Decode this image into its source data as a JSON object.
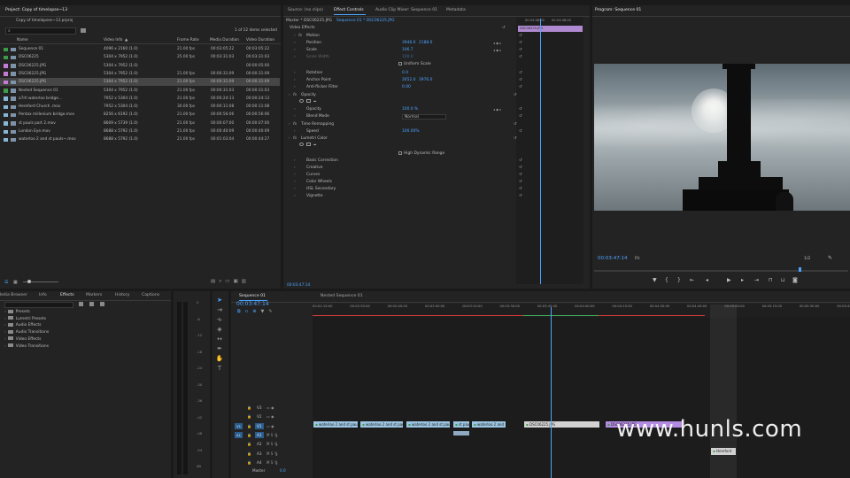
{
  "project": {
    "tab": "Project: Copy of timelapse~13",
    "file": "Copy of timelapses~13.prproj",
    "items_selected": "1 of 12 items selected",
    "columns": [
      "Name",
      "Video Info",
      "Frame Rate",
      "Media Duration",
      "Video Duration"
    ],
    "rows": [
      {
        "name": "Sequence 01",
        "info": "4096 x 2160 (1.0)",
        "rate": "21.00 fps",
        "media": "00:03:05:22",
        "video": "00:03:05:22",
        "color": "#3d9b46"
      },
      {
        "name": "DSC06225",
        "info": "5304 x 7952 (1.0)",
        "rate": "25.00 fps",
        "media": "00:03:31:03",
        "video": "00:03:31:03",
        "color": "#3d9b46"
      },
      {
        "name": "DSC06225.JPG",
        "info": "5304 x 7952 (1.0)",
        "rate": "",
        "media": "",
        "video": "00:00:05:00",
        "color": "#c57bd6"
      },
      {
        "name": "DSC06225.JPG",
        "info": "5304 x 7952 (1.0)",
        "rate": "21.00 fps",
        "media": "00:00:31:09",
        "video": "00:00:31:09",
        "color": "#c57bd6"
      },
      {
        "name": "DSC06225.JPG",
        "info": "5304 x 7952 (1.0)",
        "rate": "21.00 fps",
        "media": "00:00:31:09",
        "video": "00:00:31:09",
        "color": "#c57bd6",
        "selected": true
      },
      {
        "name": "Nested Sequence 01",
        "info": "5304 x 7952 (1.0)",
        "rate": "21.00 fps",
        "media": "00:00:31:03",
        "video": "00:00:31:03",
        "color": "#3d9b46"
      },
      {
        "name": "a7rII waterloo bridge...",
        "info": "7952 x 5304 (1.0)",
        "rate": "21.00 fps",
        "media": "00:00:24:13",
        "video": "00:00:24:13",
        "color": "#8ab6d6"
      },
      {
        "name": "Hereford Church .mov",
        "info": "7952 x 5304 (1.0)",
        "rate": "30.00 fps",
        "media": "00:00:11:08",
        "video": "00:00:11:08",
        "color": "#8ab6d6"
      },
      {
        "name": "Pentax millenium bridge.mov",
        "info": "8256 x 6192 (1.0)",
        "rate": "21.00 fps",
        "media": "00:00:56:06",
        "video": "00:00:56:06",
        "color": "#8ab6d6"
      },
      {
        "name": "st pauls part 2.mov",
        "info": "8609 x 5739 (1.0)",
        "rate": "21.00 fps",
        "media": "00:00:07:00",
        "video": "00:00:07:00",
        "color": "#8ab6d6"
      },
      {
        "name": "London Eye.mov",
        "info": "8688 x 5792 (1.0)",
        "rate": "21.00 fps",
        "media": "00:00:40:09",
        "video": "00:00:40:09",
        "color": "#8ab6d6"
      },
      {
        "name": "waterloo 2 and st pauls~.mov",
        "info": "8688 x 5792 (1.0)",
        "rate": "21.00 fps",
        "media": "00:01:03:04",
        "video": "00:00:44:27",
        "color": "#8ab6d6"
      }
    ]
  },
  "source_tabs": {
    "source": "Source: (no clips)",
    "effect_controls": "Effect Controls",
    "audio_mixer": "Audio Clip Mixer: Sequence 01",
    "metadata": "Metadata"
  },
  "effect_controls": {
    "master": "Master * DSC06225.JPG",
    "seq": "Sequence 01 * DSC06225.JPG",
    "ruler_a": "00:03:46:00",
    "ruler_b": "00:03:48:00",
    "clip": "DSC06225.JPG",
    "video_effects": "Video Effects",
    "motion": "Motion",
    "position": "Position",
    "position_x": "3948.0",
    "position_y": "2188.6",
    "scale": "Scale",
    "scale_val": "106.7",
    "scale_width": "Scale Width",
    "scale_width_val": "100.0",
    "uniform_scale": "Uniform Scale",
    "rotation": "Rotation",
    "rotation_val": "0.0",
    "anchor_point": "Anchor Point",
    "anchor_x": "2652.0",
    "anchor_y": "3976.0",
    "anti_flicker": "Anti-flicker Filter",
    "anti_flicker_val": "0.00",
    "opacity": "Opacity",
    "opacity_label": "Opacity",
    "opacity_val": "100.0 %",
    "blend_mode": "Blend Mode",
    "blend_val": "Normal",
    "time_remapping": "Time Remapping",
    "speed": "Speed",
    "speed_val": "100.00%",
    "lumetri": "Lumetri Color",
    "hdr": "High Dynamic Range",
    "basic": "Basic Correction",
    "creative": "Creative",
    "curves": "Curves",
    "wheels": "Color Wheels",
    "hsl": "HSL Secondary",
    "vignette": "Vignette",
    "timecode": "00:03:47:14"
  },
  "program": {
    "tab": "Program: Sequence 01",
    "timecode": "00:03:47:14",
    "fit": "Fit",
    "quality": "1/2"
  },
  "effects_panel": {
    "tabs": [
      "Media Browser",
      "Info",
      "Effects",
      "Markers",
      "History",
      "Captions"
    ],
    "items": [
      "Presets",
      "Lumetri Presets",
      "Audio Effects",
      "Audio Transitions",
      "Video Effects",
      "Video Transitions"
    ]
  },
  "meters": [
    "0",
    "-6",
    "-12",
    "-18",
    "-24",
    "-30",
    "-36",
    "-42",
    "-48",
    "-54",
    "dB"
  ],
  "timeline": {
    "tab1": "Sequence 01",
    "tab2": "Nested Sequence 01",
    "timecode": "00:03:47:14",
    "ruler": [
      "00:02:15:00",
      "00:02:30:00",
      "00:02:45:00",
      "00:03:00:00",
      "00:03:15:00",
      "00:03:30:00",
      "00:03:45:00",
      "00:04:00:00",
      "00:04:15:00",
      "00:04:30:00",
      "00:04:45:00",
      "00:05:00:00",
      "00:05:15:00",
      "00:05:30:00",
      "00:05:45:00"
    ],
    "tracks": [
      "V3",
      "V2",
      "V1",
      "A1",
      "A2",
      "A3",
      "A4"
    ],
    "master": "Master",
    "master_val": "0.0",
    "clips": [
      "waterloo 2 and st pauls",
      "waterloo 2 and st pauls",
      "waterloo 2 and st pauls",
      "st pauls",
      "waterloo 2 and",
      "DSC06225.JPG",
      "DSC06225.JPG",
      "Hereford"
    ]
  },
  "watermark": "www.hunls.com"
}
